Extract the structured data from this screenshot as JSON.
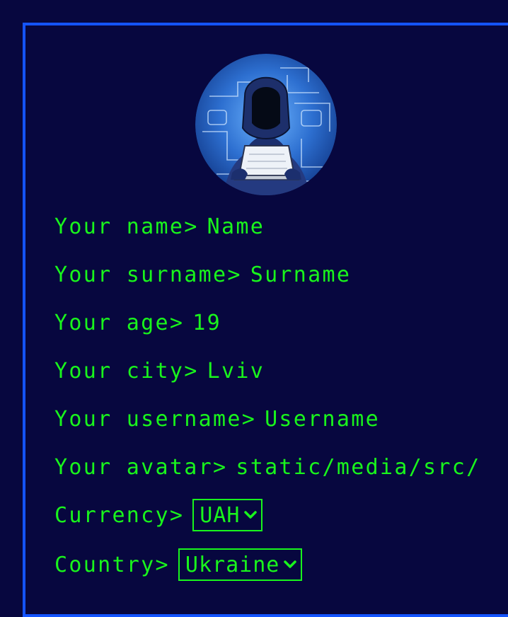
{
  "profile": {
    "name_label": "Your name>",
    "name_value": "Name",
    "surname_label": "Your surname>",
    "surname_value": "Surname",
    "age_label": "Your age>",
    "age_value": "19",
    "city_label": "Your city>",
    "city_value": "Lviv",
    "username_label": "Your username>",
    "username_value": "Username",
    "avatar_label": "Your avatar>",
    "avatar_value": "static/media/src/s",
    "currency_label": "Currency>",
    "currency_value": "UAH",
    "country_label": "Country>",
    "country_value": "Ukraine"
  },
  "colors": {
    "background": "#07073f",
    "border": "#1454ff",
    "text": "#19f51c"
  },
  "icons": {
    "avatar": "hacker-avatar-icon",
    "dropdown": "chevron-down-icon"
  }
}
